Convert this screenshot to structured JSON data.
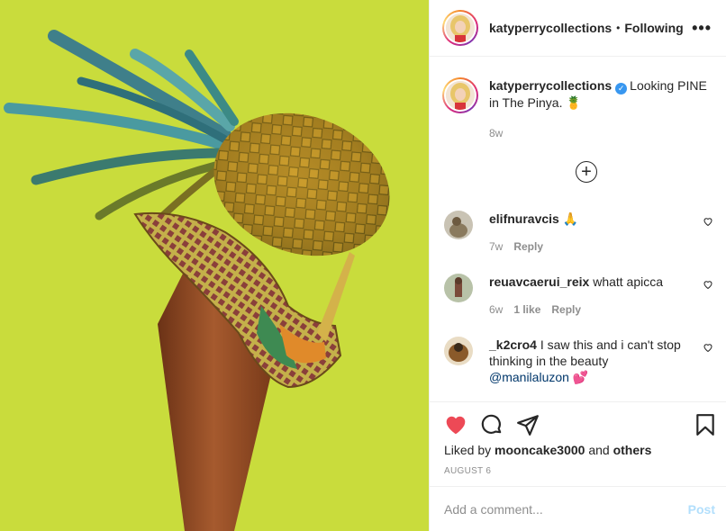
{
  "header": {
    "username": "katyperrycollections",
    "separator": "•",
    "follow_status": "Following",
    "more_label": "•••"
  },
  "caption": {
    "username": "katyperrycollections",
    "verified_icon": "verified-badge-icon",
    "text_line1": "Looking PINE",
    "text_line2": "in The Pinya. 🍍",
    "time": "8w"
  },
  "load_more_label": "+",
  "comments": [
    {
      "username": "elifnuravcis",
      "text": "🙏",
      "time": "7w",
      "likes": "",
      "reply_label": "Reply"
    },
    {
      "username": "reuavcaerui_reix",
      "text": "whatt apicca",
      "time": "6w",
      "likes": "1 like",
      "reply_label": "Reply"
    },
    {
      "username": "_k2cro4",
      "text_line1": "I saw this and i can't stop",
      "text_line2": "thinking in the beauty",
      "mention": "@manilaluzon",
      "emoji": "💕"
    }
  ],
  "actions": {
    "icons": [
      "heart-filled-icon",
      "comment-icon",
      "share-icon",
      "bookmark-icon"
    ],
    "like_color": "#ed4956",
    "liked_by_prefix": "Liked by",
    "liked_by_user": "mooncake3000",
    "liked_by_and": "and",
    "liked_by_others": "others",
    "date": "AUGUST 6"
  },
  "add_comment": {
    "placeholder": "Add a comment...",
    "post_label": "Post"
  },
  "colors": {
    "photo_background": "#c9dc3c",
    "verified": "#3897f0",
    "post_disabled": "#b2dffc"
  }
}
